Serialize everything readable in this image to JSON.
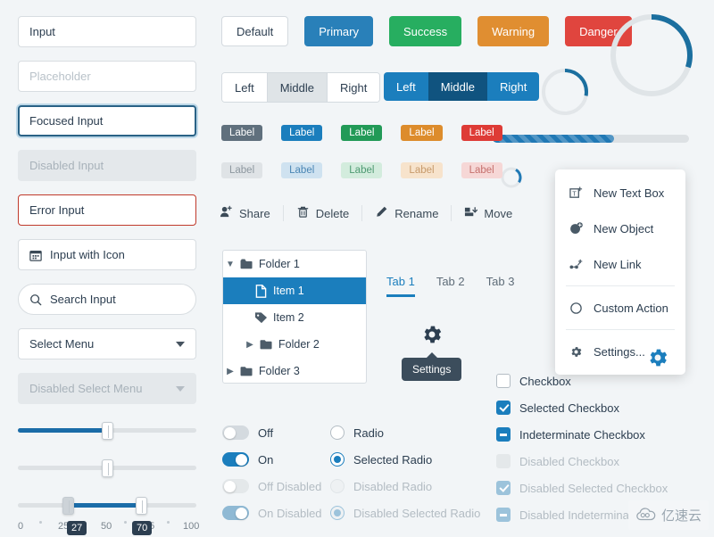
{
  "inputs": {
    "value_input": "Input",
    "placeholder_input": "Placeholder",
    "focused_input": "Focused Input",
    "disabled_input": "Disabled Input",
    "error_input": "Error Input",
    "icon_input": "Input with Icon",
    "search_input": "Search Input",
    "select_menu": "Select Menu",
    "disabled_select_menu": "Disabled Select Menu"
  },
  "sliders": {
    "single": {
      "value": 50
    },
    "center": {
      "value": 50
    },
    "range": {
      "low": 27,
      "high": 70,
      "low_label": "27",
      "high_label": "70"
    },
    "ticks": [
      "0",
      "25",
      "50",
      "75",
      "100"
    ]
  },
  "buttons": [
    {
      "label": "Default",
      "variant": "default"
    },
    {
      "label": "Primary",
      "variant": "primary"
    },
    {
      "label": "Success",
      "variant": "success"
    },
    {
      "label": "Warning",
      "variant": "warning"
    },
    {
      "label": "Danger",
      "variant": "danger"
    }
  ],
  "segmented_plain": [
    {
      "label": "Left",
      "active": false
    },
    {
      "label": "Middle",
      "active": true
    },
    {
      "label": "Right",
      "active": false
    }
  ],
  "segmented_blue": [
    {
      "label": "Left",
      "active": false
    },
    {
      "label": "Middle",
      "active": true
    },
    {
      "label": "Right",
      "active": false
    }
  ],
  "badges": {
    "solid": [
      "Label",
      "Label",
      "Label",
      "Label",
      "Label"
    ],
    "soft": [
      "Label",
      "Label",
      "Label",
      "Label",
      "Label"
    ]
  },
  "toolbar": [
    {
      "label": "Share",
      "icon": "user-add-icon"
    },
    {
      "label": "Delete",
      "icon": "trash-icon"
    },
    {
      "label": "Rename",
      "icon": "pencil-icon"
    },
    {
      "label": "Move",
      "icon": "move-icon"
    }
  ],
  "progress": {
    "percent": 62
  },
  "tree": [
    {
      "label": "Folder 1",
      "icon": "folder-open-icon",
      "chevron": "down",
      "depth": 0,
      "selected": false
    },
    {
      "label": "Item 1",
      "icon": "file-icon",
      "chevron": "none",
      "depth": 1,
      "selected": true
    },
    {
      "label": "Item 2",
      "icon": "tag-icon",
      "chevron": "none",
      "depth": 1,
      "selected": false
    },
    {
      "label": "Folder 2",
      "icon": "folder-icon",
      "chevron": "right",
      "depth": 1,
      "selected": false
    },
    {
      "label": "Folder 3",
      "icon": "folder-icon",
      "chevron": "right",
      "depth": 0,
      "selected": false
    }
  ],
  "tabs": [
    {
      "label": "Tab 1",
      "active": true
    },
    {
      "label": "Tab 2",
      "active": false
    },
    {
      "label": "Tab 3",
      "active": false
    }
  ],
  "tooltip": {
    "text": "Settings"
  },
  "menu": [
    {
      "label": "New Text Box",
      "icon": "text-box-add-icon"
    },
    {
      "label": "New Object",
      "icon": "object-add-icon"
    },
    {
      "label": "New Link",
      "icon": "link-add-icon"
    },
    {
      "label": "Custom Action",
      "icon": "circle-icon",
      "separator_before": true
    },
    {
      "label": "Settings...",
      "icon": "gear-icon",
      "separator_before": true
    }
  ],
  "switches": [
    {
      "label": "Off",
      "on": false,
      "disabled": false
    },
    {
      "label": "On",
      "on": true,
      "disabled": false
    },
    {
      "label": "Off Disabled",
      "on": false,
      "disabled": true
    },
    {
      "label": "On Disabled",
      "on": true,
      "disabled": true
    }
  ],
  "radios": [
    {
      "label": "Radio",
      "on": false,
      "disabled": false
    },
    {
      "label": "Selected Radio",
      "on": true,
      "disabled": false
    },
    {
      "label": "Disabled Radio",
      "on": false,
      "disabled": true
    },
    {
      "label": "Disabled Selected Radio",
      "on": true,
      "disabled": true
    }
  ],
  "checkboxes": [
    {
      "label": "Checkbox",
      "state": "off",
      "disabled": false
    },
    {
      "label": "Selected Checkbox",
      "state": "on",
      "disabled": false
    },
    {
      "label": "Indeterminate Checkbox",
      "state": "ind",
      "disabled": false
    },
    {
      "label": "Disabled Checkbox",
      "state": "off",
      "disabled": true
    },
    {
      "label": "Disabled Selected Checkbox",
      "state": "on",
      "disabled": true
    },
    {
      "label": "Disabled Indeterminate Checkbox",
      "state": "ind",
      "disabled": true
    }
  ],
  "spinners": {
    "big_percent": 30,
    "small_percent": 28,
    "tiny_percent": 25
  },
  "watermark": {
    "text": "亿速云"
  },
  "colors": {
    "primary": "#1b7ebd",
    "success": "#229a57",
    "warning": "#dd8c2c",
    "danger": "#de3b36",
    "default": "#60707d",
    "background": "#f2f5f7"
  }
}
